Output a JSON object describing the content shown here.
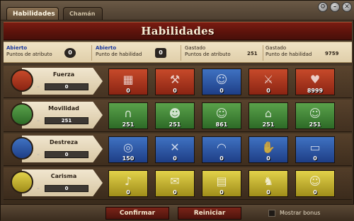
{
  "tabs": [
    {
      "label": "Habilidades"
    },
    {
      "label": "Chamán"
    }
  ],
  "window_buttons": [
    "gear-icon",
    "minimize-icon",
    "close-icon"
  ],
  "title": "Habilidades",
  "info": {
    "attr_open_label_1": "Abierto",
    "attr_open_label_2": "Puntos de atributo",
    "attr_open_value": "0",
    "skill_open_label_1": "Abierto",
    "skill_open_label_2": "Punto de habilidad",
    "skill_open_value": "0",
    "attr_spent_label_1": "Gastado",
    "attr_spent_label_2": "Puntos de atributo",
    "attr_spent_value": "251",
    "skill_spent_label_1": "Gastado",
    "skill_spent_label_2": "Punto de habilidad",
    "skill_spent_value": "9759"
  },
  "rows": [
    {
      "attribute": "Fuerza",
      "attribute_value": "0",
      "color": "red",
      "skills": [
        {
          "value": "0",
          "icon": "bricks-icon"
        },
        {
          "value": "0",
          "icon": "hammer-icon"
        },
        {
          "value": "0",
          "icon": "cowboy-icon"
        },
        {
          "value": "0",
          "icon": "tools-icon"
        },
        {
          "value": "8999",
          "icon": "heart-icon"
        }
      ]
    },
    {
      "attribute": "Movilidad",
      "attribute_value": "251",
      "color": "green",
      "skills": [
        {
          "value": "251",
          "icon": "horseshoe-icon"
        },
        {
          "value": "251",
          "icon": "duel-icon"
        },
        {
          "value": "861",
          "icon": "cowboy-icon"
        },
        {
          "value": "251",
          "icon": "hat-icon"
        },
        {
          "value": "251",
          "icon": "cowboy-icon"
        }
      ]
    },
    {
      "attribute": "Destreza",
      "attribute_value": "0",
      "color": "blue",
      "skills": [
        {
          "value": "150",
          "icon": "target-icon"
        },
        {
          "value": "0",
          "icon": "pistols-icon"
        },
        {
          "value": "0",
          "icon": "trap-icon"
        },
        {
          "value": "0",
          "icon": "hand-icon"
        },
        {
          "value": "0",
          "icon": "rifle-icon"
        }
      ]
    },
    {
      "attribute": "Carisma",
      "attribute_value": "0",
      "color": "yellow",
      "skills": [
        {
          "value": "0",
          "icon": "horn-icon"
        },
        {
          "value": "0",
          "icon": "scroll-icon"
        },
        {
          "value": "0",
          "icon": "map-icon"
        },
        {
          "value": "0",
          "icon": "horse-icon"
        },
        {
          "value": "0",
          "icon": "sheriff-icon"
        }
      ]
    }
  ],
  "buttons": {
    "confirm": "Confirmar",
    "reset": "Reiniciar"
  },
  "show_bonus_label": "Mostrar bonus"
}
